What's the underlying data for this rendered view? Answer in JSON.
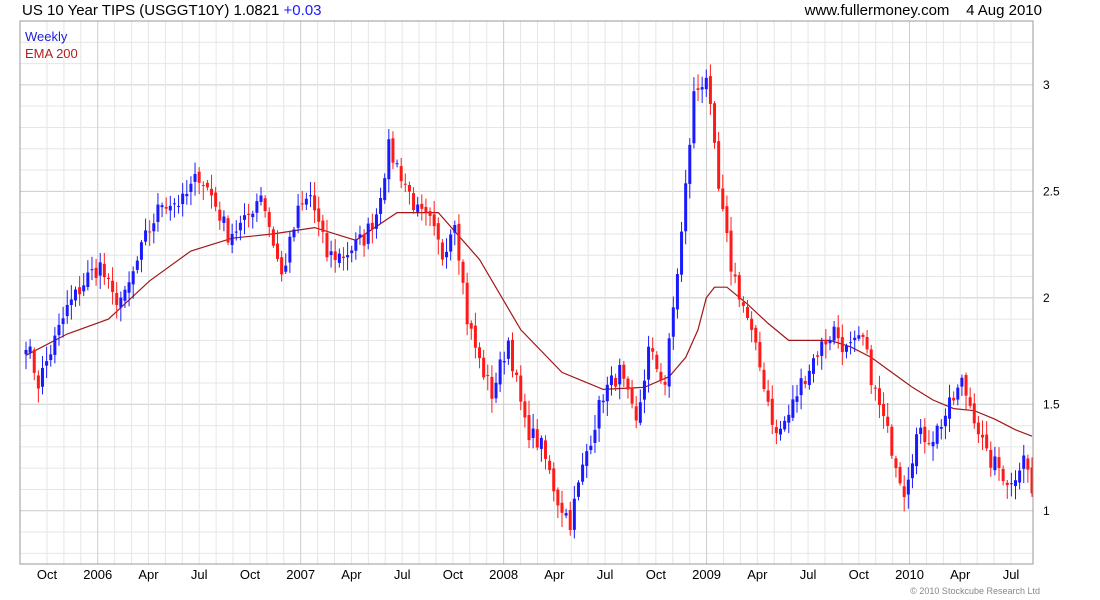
{
  "header": {
    "title": "US 10 Year TIPS (USGGT10Y)",
    "last": "1.0821",
    "change": "+0.03",
    "site": "www.fullermoney.com",
    "date": "4 Aug 2010"
  },
  "legend": [
    "Weekly",
    "EMA 200"
  ],
  "copyright": "© 2010 Stockcube Research Ltd",
  "colors": {
    "up": "#1a1aff",
    "down": "#ff1a1a",
    "ema": "#a01818",
    "grid": "#cccccc",
    "grid_minor": "#e6e6e6"
  },
  "chart_data": {
    "type": "candlestick",
    "ylim": [
      0.75,
      3.3
    ],
    "yticks": [
      1,
      1.5,
      2,
      2.5,
      3
    ],
    "xlabels": [
      "Oct",
      "2006",
      "Apr",
      "Jul",
      "Oct",
      "2007",
      "Apr",
      "Jul",
      "Oct",
      "2008",
      "Apr",
      "Jul",
      "Oct",
      "2009",
      "Apr",
      "Jul",
      "Oct",
      "2010",
      "Apr",
      "Jul"
    ],
    "series": [
      {
        "name": "Weekly",
        "type": "candlestick",
        "close_anchors": [
          [
            0,
            1.8
          ],
          [
            3,
            1.6
          ],
          [
            6,
            1.75
          ],
          [
            10,
            1.95
          ],
          [
            15,
            2.1
          ],
          [
            18,
            2.15
          ],
          [
            21,
            2.0
          ],
          [
            24,
            2.0
          ],
          [
            29,
            2.28
          ],
          [
            33,
            2.45
          ],
          [
            38,
            2.45
          ],
          [
            42,
            2.58
          ],
          [
            45,
            2.48
          ],
          [
            49,
            2.3
          ],
          [
            53,
            2.35
          ],
          [
            57,
            2.5
          ],
          [
            62,
            2.1
          ],
          [
            66,
            2.4
          ],
          [
            69,
            2.48
          ],
          [
            73,
            2.2
          ],
          [
            77,
            2.2
          ],
          [
            82,
            2.28
          ],
          [
            85,
            2.4
          ],
          [
            88,
            2.7
          ],
          [
            91,
            2.58
          ],
          [
            95,
            2.4
          ],
          [
            98,
            2.35
          ],
          [
            101,
            2.2
          ],
          [
            104,
            2.38
          ],
          [
            107,
            1.9
          ],
          [
            110,
            1.7
          ],
          [
            113,
            1.55
          ],
          [
            117,
            1.8
          ],
          [
            121,
            1.4
          ],
          [
            125,
            1.3
          ],
          [
            129,
            1.05
          ],
          [
            132,
            0.95
          ],
          [
            136,
            1.28
          ],
          [
            140,
            1.55
          ],
          [
            144,
            1.65
          ],
          [
            148,
            1.4
          ],
          [
            151,
            1.75
          ],
          [
            155,
            1.6
          ],
          [
            159,
            2.3
          ],
          [
            162,
            2.95
          ],
          [
            165,
            3.05
          ],
          [
            168,
            2.5
          ],
          [
            171,
            2.15
          ],
          [
            175,
            1.9
          ],
          [
            179,
            1.6
          ],
          [
            182,
            1.35
          ],
          [
            185,
            1.45
          ],
          [
            188,
            1.6
          ],
          [
            192,
            1.75
          ],
          [
            196,
            1.85
          ],
          [
            199,
            1.75
          ],
          [
            203,
            1.8
          ],
          [
            206,
            1.55
          ],
          [
            210,
            1.3
          ],
          [
            213,
            1.1
          ],
          [
            216,
            1.35
          ],
          [
            220,
            1.35
          ],
          [
            223,
            1.45
          ],
          [
            227,
            1.6
          ],
          [
            230,
            1.45
          ],
          [
            233,
            1.25
          ],
          [
            236,
            1.2
          ],
          [
            239,
            1.12
          ],
          [
            242,
            1.28
          ],
          [
            244,
            1.08
          ]
        ],
        "high_max": 3.15,
        "low_min": 0.87,
        "last_close": 1.0821
      },
      {
        "name": "EMA 200",
        "type": "line",
        "points": [
          [
            0,
            1.73
          ],
          [
            10,
            1.83
          ],
          [
            20,
            1.9
          ],
          [
            30,
            2.08
          ],
          [
            40,
            2.22
          ],
          [
            50,
            2.28
          ],
          [
            60,
            2.3
          ],
          [
            70,
            2.33
          ],
          [
            80,
            2.27
          ],
          [
            90,
            2.4
          ],
          [
            100,
            2.4
          ],
          [
            110,
            2.18
          ],
          [
            120,
            1.85
          ],
          [
            130,
            1.65
          ],
          [
            140,
            1.57
          ],
          [
            150,
            1.58
          ],
          [
            156,
            1.63
          ],
          [
            160,
            1.72
          ],
          [
            163,
            1.85
          ],
          [
            165,
            2.0
          ],
          [
            167,
            2.05
          ],
          [
            170,
            2.05
          ],
          [
            175,
            1.97
          ],
          [
            180,
            1.88
          ],
          [
            185,
            1.8
          ],
          [
            190,
            1.8
          ],
          [
            195,
            1.8
          ],
          [
            200,
            1.77
          ],
          [
            205,
            1.72
          ],
          [
            210,
            1.65
          ],
          [
            215,
            1.58
          ],
          [
            220,
            1.52
          ],
          [
            225,
            1.48
          ],
          [
            230,
            1.47
          ],
          [
            235,
            1.43
          ],
          [
            240,
            1.38
          ],
          [
            244,
            1.35
          ]
        ]
      }
    ]
  }
}
